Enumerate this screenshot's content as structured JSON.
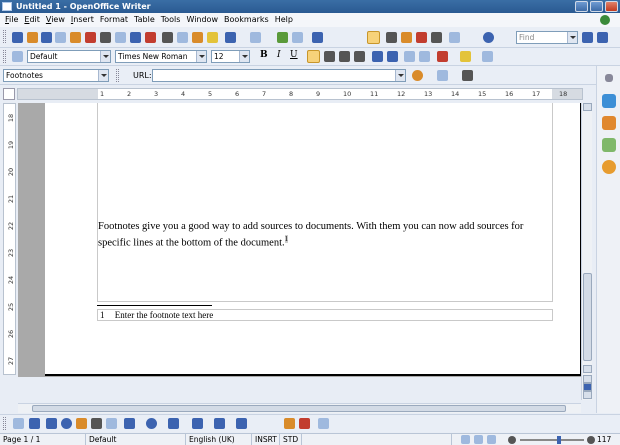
{
  "window": {
    "title": "Untitled 1 - OpenOffice Writer"
  },
  "menu": [
    {
      "ul": "F",
      "rest": "ile"
    },
    {
      "ul": "E",
      "rest": "dit"
    },
    {
      "ul": "V",
      "rest": "iew"
    },
    {
      "ul": "I",
      "rest": "nsert"
    },
    {
      "ul": "",
      "rest": "Format"
    },
    {
      "ul": "",
      "rest": "Table"
    },
    {
      "ul": "",
      "rest": "Tools"
    },
    {
      "ul": "",
      "rest": "Window"
    },
    {
      "ul": "",
      "rest": "Bookmarks"
    },
    {
      "ul": "",
      "rest": "Help"
    }
  ],
  "standard_toolbar": {
    "find_placeholder": "Find"
  },
  "formatting_toolbar": {
    "paragraph_style": "Default",
    "font_name": "Times New Roman",
    "font_size": "12",
    "bold": "B",
    "italic": "I",
    "underline": "U"
  },
  "hyperlink_bar": {
    "style": "Footnotes",
    "url_label": "URL:",
    "url_value": ""
  },
  "ruler": {
    "h_ticks": [
      "1",
      "2",
      "3",
      "4",
      "5",
      "6",
      "7",
      "8",
      "9",
      "10",
      "11",
      "12",
      "13",
      "14",
      "15",
      "16",
      "17",
      "18"
    ],
    "v_ticks": [
      "18",
      "19",
      "20",
      "21",
      "22",
      "23",
      "24",
      "25",
      "26",
      "27"
    ]
  },
  "document": {
    "body": "Footnotes give you a good way to add sources to documents. With them you can now add sources for specific lines at the bottom of the document.",
    "anchor": "1",
    "footnote_number": "1",
    "footnote_text": "Enter the footnote text here"
  },
  "statusbar": {
    "page": "Page 1 / 1",
    "style": "Default",
    "language": "English (UK)",
    "insert_mode": "INSRT",
    "selection_mode": "STD",
    "zoom": "117 %",
    "zoom_fraction": 0.62
  },
  "icons": [
    "new-icon",
    "open-icon",
    "save-icon",
    "email-icon",
    "edit-icon",
    "pdf-icon",
    "print-icon",
    "print-preview-icon",
    "spellcheck-icon",
    "autospell-icon",
    "cut-icon",
    "copy-icon",
    "paste-icon",
    "format-paintbrush-icon",
    "undo-icon",
    "redo-icon",
    "hyperlink-icon",
    "table-icon",
    "show-draw-functions-icon",
    "find-replace-icon",
    "navigator-icon",
    "gallery-icon",
    "data-sources-icon",
    "nonprinting-chars-icon",
    "zoom-icon",
    "help-icon"
  ]
}
